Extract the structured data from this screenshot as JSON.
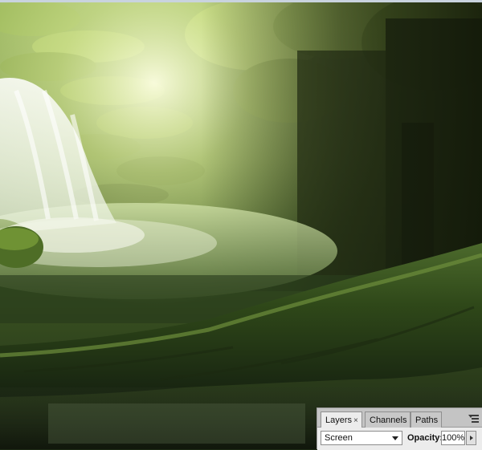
{
  "canvas": {
    "scene": "forest-waterfall-artwork"
  },
  "layers_panel": {
    "tabs": [
      {
        "label": "Layers",
        "active": true,
        "close_glyph": "×"
      },
      {
        "label": "Channels",
        "active": false
      },
      {
        "label": "Paths",
        "active": false
      }
    ],
    "blend_mode": "Screen",
    "opacity_label": "Opacity:",
    "opacity_value": "100%"
  },
  "icons": {
    "panel_menu": "panel-menu-icon",
    "dropdown": "chevron-down-icon",
    "stepper": "triangle-right-icon"
  }
}
